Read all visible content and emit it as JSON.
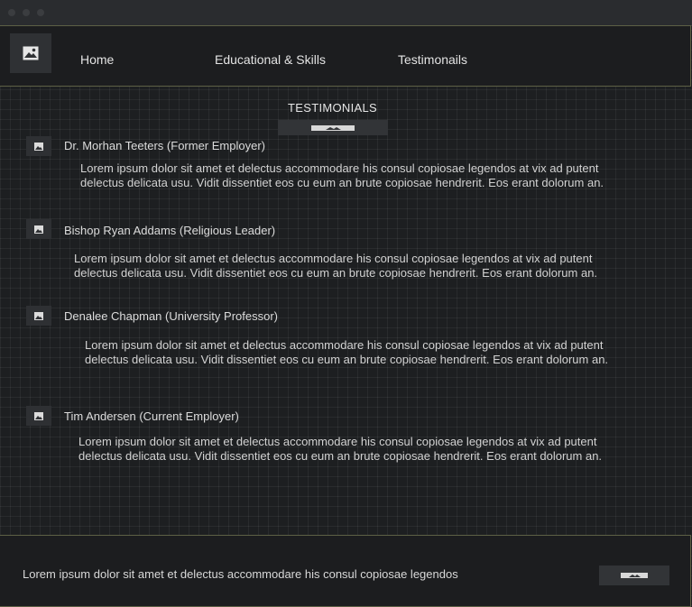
{
  "window": {
    "icons": [
      "close-dot",
      "minimize-dot",
      "maximize-dot"
    ]
  },
  "nav": {
    "logo_icon": "image-icon",
    "links": [
      "Home",
      "Educational & Skills",
      "Testimonails"
    ]
  },
  "section": {
    "title": "TESTIMONIALS",
    "title_image_icon": "image-placeholder-icon"
  },
  "testimonials": [
    {
      "name": "Dr. Morhan Teeters (Former Employer)",
      "text_line1": "Lorem ipsum dolor sit amet et delectus accommodare his consul copiosae legendos at vix ad putent",
      "text_line2": "delectus delicata usu. Vidit dissentiet eos cu eum an brute copiosae hendrerit. Eos erant dolorum an."
    },
    {
      "name": "Bishop Ryan Addams (Religious Leader)",
      "text_line1": "Lorem ipsum dolor sit amet et delectus accommodare his consul copiosae legendos at vix ad putent",
      "text_line2": "delectus delicata usu. Vidit dissentiet eos cu eum an brute copiosae hendrerit. Eos erant dolorum an."
    },
    {
      "name": "Denalee Chapman (University Professor)",
      "text_line1": "Lorem ipsum dolor sit amet et delectus accommodare his consul copiosae legendos at vix ad putent",
      "text_line2": "delectus delicata usu. Vidit dissentiet eos cu eum an brute copiosae hendrerit. Eos erant dolorum an."
    },
    {
      "name": "Tim Andersen (Current Employer)",
      "text_line1": "Lorem ipsum dolor sit amet et delectus accommodare his consul copiosae legendos at vix ad putent",
      "text_line2": "delectus delicata usu. Vidit dissentiet eos cu eum an brute copiosae hendrerit. Eos erant dolorum an."
    }
  ],
  "footer": {
    "text": "Lorem ipsum dolor sit amet et delectus accommodare his consul copiosae legendos",
    "image_icon": "image-placeholder-icon"
  },
  "colors": {
    "background": "#1d1f21",
    "border_accent": "#5d6045",
    "text": "#d6d6d6"
  }
}
